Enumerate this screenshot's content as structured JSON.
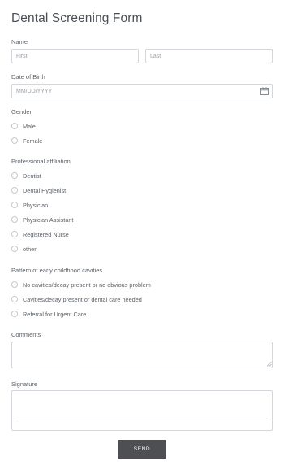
{
  "form": {
    "title": "Dental Screening Form",
    "name": {
      "label": "Name",
      "first_placeholder": "First",
      "last_placeholder": "Last"
    },
    "dob": {
      "label": "Date of Birth",
      "placeholder": "MM/DD/YYYY",
      "icon": "calendar-icon"
    },
    "gender": {
      "label": "Gender",
      "options": [
        "Male",
        "Female"
      ]
    },
    "affiliation": {
      "label": "Professional affiliation",
      "options": [
        "Dentist",
        "Dental Hygienist",
        "Physician",
        "Physician Assistant",
        "Registered Nurse",
        "other:"
      ]
    },
    "cavities": {
      "label": "Pattern of early childhood cavities",
      "options": [
        "No cavities/decay present or no obvious problem",
        "Cavities/decay present or dental care needed",
        "Referral for Urgent Care"
      ]
    },
    "comments": {
      "label": "Comments"
    },
    "signature": {
      "label": "Signature"
    },
    "send_label": "SEND"
  },
  "colors": {
    "text": "#555a60",
    "border": "#d3d6da",
    "button_bg": "#4d4f52",
    "button_text": "#ffffff"
  }
}
